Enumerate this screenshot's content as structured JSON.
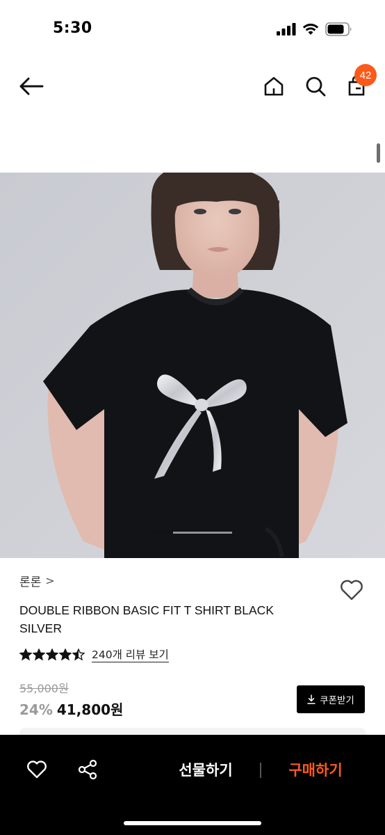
{
  "status_bar": {
    "time": "5:30"
  },
  "header": {
    "cart_count": "42"
  },
  "carousel": {
    "slide_progress": 0.25
  },
  "product": {
    "brand": "론론",
    "brand_chevron": ">",
    "name_line1": "DOUBLE RIBBON BASIC FIT T SHIRT BLACK",
    "name_line2": "SILVER",
    "rating": 4.5,
    "review_link": "240개 리뷰 보기",
    "original_price": "55,000원",
    "discount": "24%",
    "sale_price": "41,800원",
    "coupon_label": "쿠폰받기"
  },
  "bottom_bar": {
    "gift_label": "선물하기",
    "buy_label": "구매하기"
  },
  "colors": {
    "accent": "#ff5a1f",
    "badge": "#fb5a1a"
  },
  "icons": {
    "back": "arrow-left-icon",
    "home": "home-icon",
    "search": "search-icon",
    "cart": "shopping-bag-icon",
    "wish": "heart-icon",
    "share": "share-icon",
    "download": "download-icon"
  }
}
